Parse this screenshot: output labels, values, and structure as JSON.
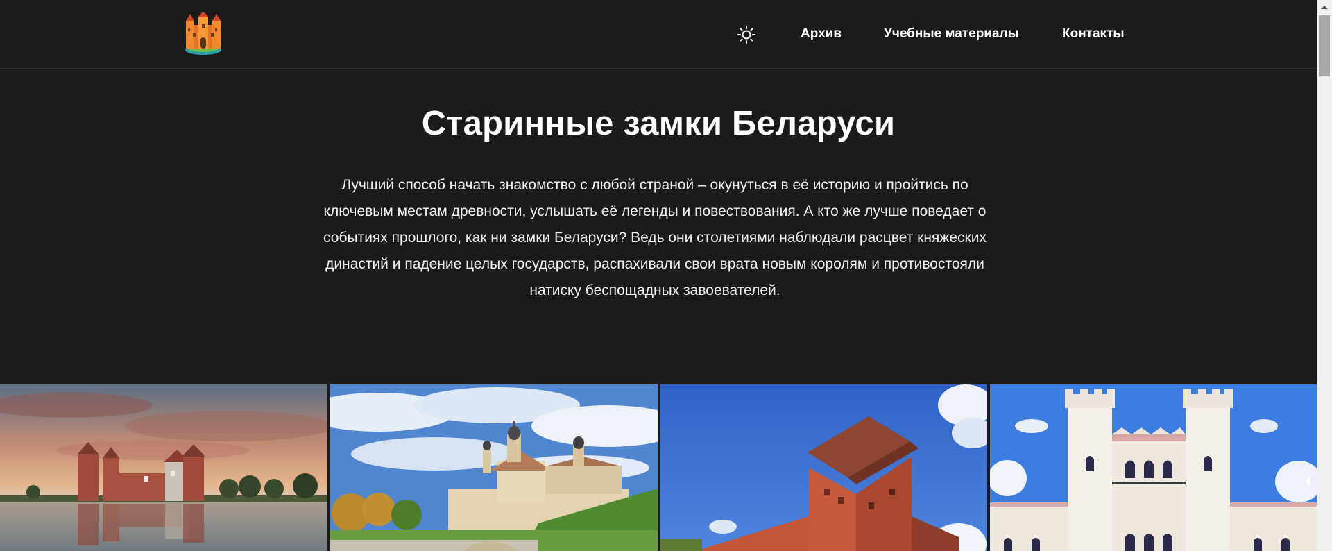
{
  "header": {
    "logo_icon": "castle-logo-icon",
    "theme_icon": "sun-icon",
    "nav": [
      {
        "label": "Архив"
      },
      {
        "label": "Учебные материалы"
      },
      {
        "label": "Контакты"
      }
    ]
  },
  "hero": {
    "title": "Старинные замки Беларуси",
    "text": "Лучший способ начать знакомство с любой страной – окунуться в её историю и пройтись по ключевым местам древности, услышать её легенды и повествования. А кто же лучше поведает о событиях прошлого, как ни замки Беларуси? Ведь они столетиями наблюдали расцвет княжеских династий и падение целых государств, распахивали свои врата новым королям и противостояли натиску беспощадных завоевателей."
  },
  "gallery": {
    "items": [
      {
        "image": "mir-castle-photo"
      },
      {
        "image": "nesvizh-castle-photo"
      },
      {
        "image": "lida-castle-tower-photo"
      },
      {
        "image": "kossovo-palace-photo"
      }
    ]
  },
  "colors": {
    "background": "#1b1b1b",
    "text": "#ffffff",
    "divider": "#343434"
  }
}
